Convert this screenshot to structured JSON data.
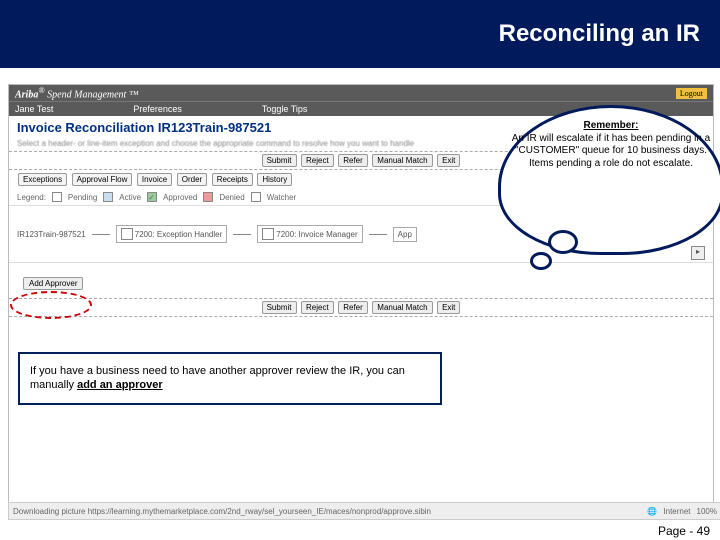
{
  "title": "Reconciling an IR",
  "pageNumber": "Page - 49",
  "ariba": {
    "brand": "Ariba",
    "product": "Spend Management",
    "logout": "Logout",
    "user": "Jane Test",
    "nav1": "Preferences",
    "nav2": "Toggle Tips"
  },
  "ir": {
    "title": "Invoice Reconciliation IR123Train-987521",
    "instruction": "Select a header- or line-item exception and choose the appropriate command to resolve how you want to handle"
  },
  "buttons": {
    "submit": "Submit",
    "reject": "Reject",
    "refer": "Refer",
    "manualMatch": "Manual Match",
    "exit": "Exit",
    "addApprover": "Add Approver"
  },
  "tabs": {
    "exceptions": "Exceptions",
    "approvalFlow": "Approval Flow",
    "invoice": "Invoice",
    "order": "Order",
    "receipts": "Receipts",
    "history": "History"
  },
  "legend": {
    "label": "Legend:",
    "pending": "Pending",
    "active": "Active",
    "approved": "Approved",
    "denied": "Denied",
    "watcher": "Watcher"
  },
  "flow": {
    "start": "IR123Train-987521",
    "node1": "7200: Exception Handler",
    "node2": "7200: Invoice Manager",
    "node3": "App",
    "scrollRight": "▸"
  },
  "cloud": {
    "header": "Remember:",
    "body": "An IR will escalate if it has been pending in a \"CUSTOMER\" queue for 10 business days. Items pending a role do not escalate."
  },
  "callout": {
    "pre": "If you have a business need to have another approver review the IR, you can manually ",
    "bold": "add an approver"
  },
  "status": {
    "left": "Downloading picture https://learning.mythemarketplace.com/2nd_rway/sel_yourseen_IE/maces/nonprod/approve.sibin",
    "internet": "Internet",
    "zoom": "100%"
  }
}
